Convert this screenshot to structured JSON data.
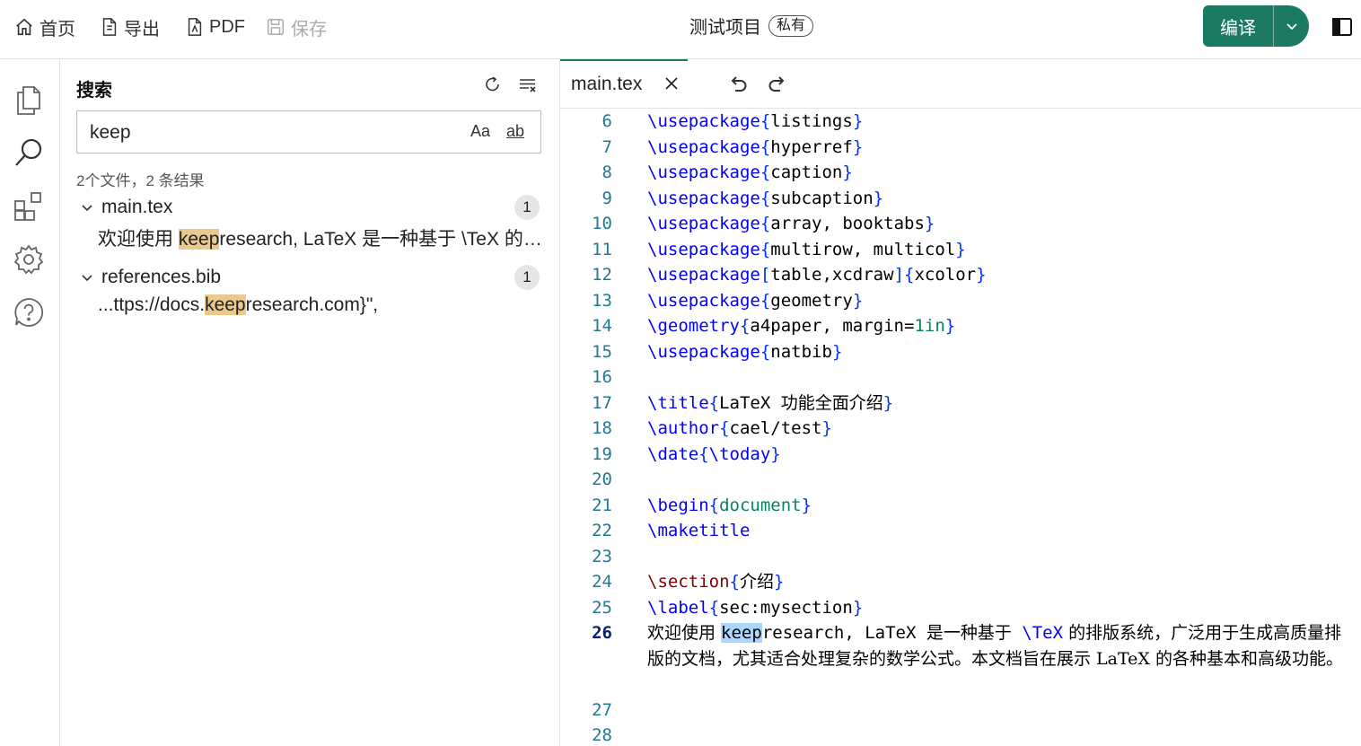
{
  "toolbar": {
    "home": "首页",
    "export": "导出",
    "pdf": "PDF",
    "save": "保存",
    "project_name": "测试项目",
    "privacy_badge": "私有",
    "compile": "编译"
  },
  "search_panel": {
    "title": "搜索",
    "query": "keep",
    "case_option": "Aa",
    "word_option": "ab",
    "summary": "2个文件，2 条结果",
    "results": [
      {
        "file": "main.tex",
        "count": "1",
        "pre": "欢迎使用 ",
        "hit": "keep",
        "post": "research, LaTeX 是一种基于 \\TeX 的排版系统"
      },
      {
        "file": "references.bib",
        "count": "1",
        "pre": "...ttps://docs.",
        "hit": "keep",
        "post": "research.com}\","
      }
    ]
  },
  "editor": {
    "tab_name": "main.tex",
    "lines": [
      {
        "n": "6",
        "cmd": "\\usepackage",
        "args": "{listings}"
      },
      {
        "n": "7",
        "cmd": "\\usepackage",
        "args": "{hyperref}"
      },
      {
        "n": "8",
        "cmd": "\\usepackage",
        "args": "{caption}"
      },
      {
        "n": "9",
        "cmd": "\\usepackage",
        "args": "{subcaption}"
      },
      {
        "n": "10",
        "cmd": "\\usepackage",
        "args": "{array, booktabs}"
      },
      {
        "n": "11",
        "cmd": "\\usepackage",
        "args": "{multirow, multicol}"
      },
      {
        "n": "12",
        "cmd": "\\usepackage",
        "args": "[table,xcdraw]{xcolor}"
      },
      {
        "n": "13",
        "cmd": "\\usepackage",
        "args": "{geometry}"
      },
      {
        "n": "14",
        "cmd": "\\geometry",
        "args": "{a4paper, margin=1in}"
      },
      {
        "n": "15",
        "cmd": "\\usepackage",
        "args": "{natbib}"
      },
      {
        "n": "16",
        "cmd": "",
        "args": ""
      },
      {
        "n": "17",
        "cmd": "\\title",
        "args": "{LaTeX 功能全面介绍}"
      },
      {
        "n": "18",
        "cmd": "\\author",
        "args": "{cael/test}"
      },
      {
        "n": "19",
        "cmd": "\\date",
        "args": "{\\today}"
      },
      {
        "n": "20",
        "cmd": "",
        "args": ""
      },
      {
        "n": "21",
        "cmd": "\\begin",
        "args": "{document}"
      },
      {
        "n": "22",
        "cmd": "\\maketitle",
        "args": ""
      },
      {
        "n": "23",
        "cmd": "",
        "args": ""
      },
      {
        "n": "24",
        "cmd": "\\section",
        "args": "{介绍}"
      },
      {
        "n": "25",
        "cmd": "\\label",
        "args": "{sec:mysection}"
      }
    ],
    "para_line_number": "26",
    "para": {
      "p1": "欢迎使用 ",
      "hit": "keep",
      "p2": "research, LaTeX 是一种基于 ",
      "tex": "\\TeX",
      "p3": " 的排版系统，广泛用于生成高质量排版的文档，尤其适合处理复杂的数学公式。本文档旨在展示 LaTeX 的各种基本和高级功能。"
    },
    "tail_lines": [
      "27",
      "28"
    ]
  }
}
